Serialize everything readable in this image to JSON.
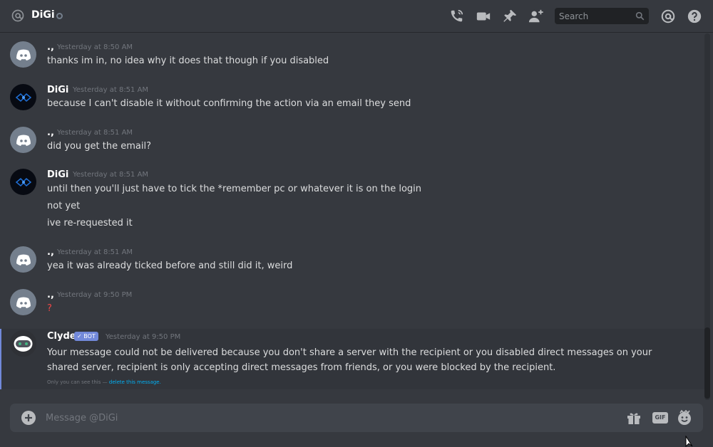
{
  "header": {
    "channel_name": "DiGi",
    "search_placeholder": "Search",
    "icons": [
      "at-icon",
      "call-icon",
      "video-icon",
      "pin-icon",
      "add-friend-icon",
      "search-icon",
      "mention-icon",
      "help-icon"
    ]
  },
  "messages": [
    {
      "author": ".,",
      "timestamp": "Yesterday at 8:50 AM",
      "lines": [
        "thanks im in, no idea why it does that though if you disabled"
      ]
    },
    {
      "author": "DiGi",
      "timestamp": "Yesterday at 8:51 AM",
      "lines": [
        "because I can't disable it without confirming the action via an email they send"
      ]
    },
    {
      "author": ".,",
      "timestamp": "Yesterday at 8:51 AM",
      "lines": [
        "did you get the email?"
      ]
    },
    {
      "author": "DiGi",
      "timestamp": "Yesterday at 8:51 AM",
      "lines": [
        "until then you'll just have to tick the *remember pc or whatever it is on the login",
        "not yet",
        "ive re-requested it"
      ]
    },
    {
      "author": ".,",
      "timestamp": "Yesterday at 8:51 AM",
      "lines": [
        "yea it was already ticked before and still did it, weird"
      ]
    },
    {
      "author": ".,",
      "timestamp": "Yesterday at 9:50 PM",
      "lines": [
        "?"
      ]
    }
  ],
  "clyde": {
    "author": "Clyde",
    "badge": "✓ BOT",
    "timestamp": "Yesterday at 9:50 PM",
    "text": "Your message could not be delivered because you don't share a server with the recipient or you disabled direct messages on your shared server, recipient is only accepting direct messages from friends, or you were blocked by the recipient.",
    "ephemeral_note": "Only you can see this —",
    "ephemeral_link": "delete this message."
  },
  "composer": {
    "placeholder": "Message @DiGi",
    "gif_label": "GIF"
  },
  "colors": {
    "background": "#36393f",
    "accent": "#7289da",
    "error": "#f04747",
    "link": "#00b0f4"
  }
}
